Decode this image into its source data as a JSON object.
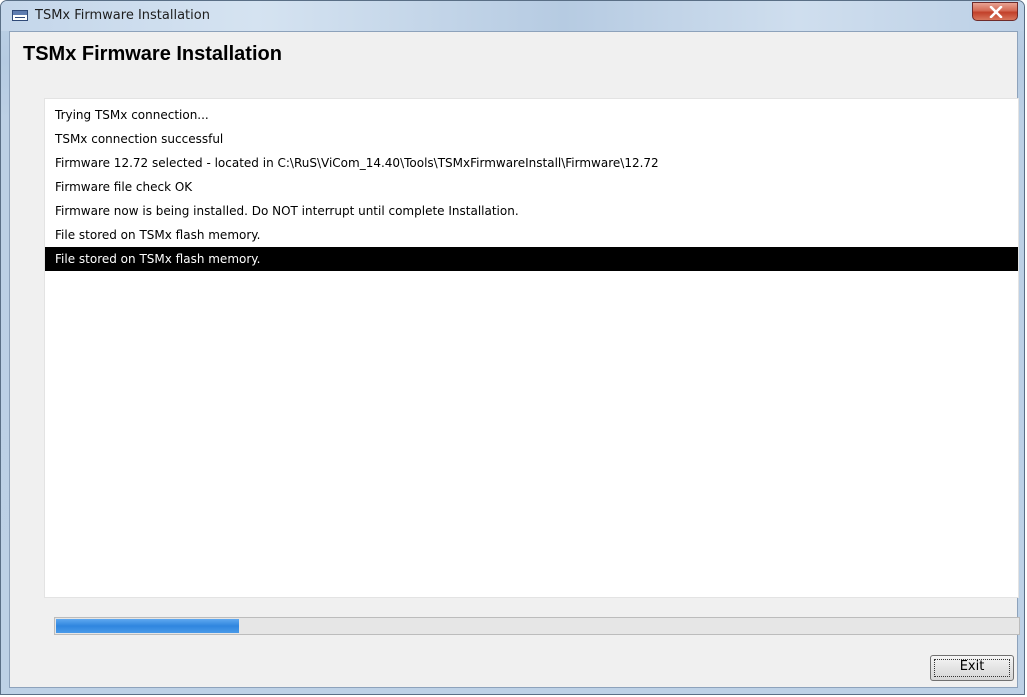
{
  "window": {
    "title": "TSMx Firmware Installation",
    "app_icon": "firmware-app-icon",
    "close_icon": "close-icon"
  },
  "header": {
    "heading": "TSMx Firmware Installation"
  },
  "log": {
    "lines": [
      "Trying TSMx connection...",
      "TSMx connection successful",
      "Firmware 12.72 selected  - located in C:\\RuS\\ViCom_14.40\\Tools\\TSMxFirmwareInstall\\Firmware\\12.72",
      "Firmware file check OK",
      "Firmware now is being installed. Do NOT interrupt until complete Installation.",
      "File stored on TSMx flash memory.",
      "File stored on TSMx flash memory."
    ],
    "selected_index": 6
  },
  "progress": {
    "fraction": 0.19,
    "color": "#3a8fe3"
  },
  "buttons": {
    "exit_label": "Exit"
  }
}
